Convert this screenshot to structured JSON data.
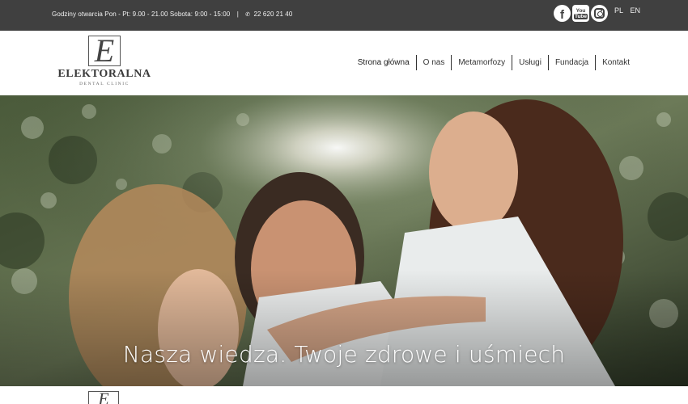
{
  "topbar": {
    "hours": "Godziny otwarcia Pon - Pt: 9.00 - 21.00 Sobota: 9:00 - 15:00",
    "separator": "|",
    "phone_icon": "✆",
    "phone": "22 620 21 40",
    "socials": {
      "facebook_icon": "f",
      "youtube_icon_top": "You",
      "youtube_icon_bottom": "Tube",
      "instagram_icon": "instagram-icon"
    },
    "languages": [
      "PL",
      "EN"
    ]
  },
  "logo": {
    "monogram": "E",
    "name": "ELEKTORALNA",
    "subtitle": "DENTAL CLINIC"
  },
  "nav": {
    "items": [
      "Strona główna",
      "O nas",
      "Metamorfozy",
      "Usługi",
      "Fundacja",
      "Kontakt"
    ],
    "active_index": 0
  },
  "hero": {
    "tagline": "Nasza wiedza. Twoje zdrowe i uśmiech"
  },
  "bottom": {
    "monogram": "E"
  },
  "colors": {
    "topbar_bg": "#404040",
    "text_dark": "#333333",
    "hero_green": "#33402a"
  }
}
